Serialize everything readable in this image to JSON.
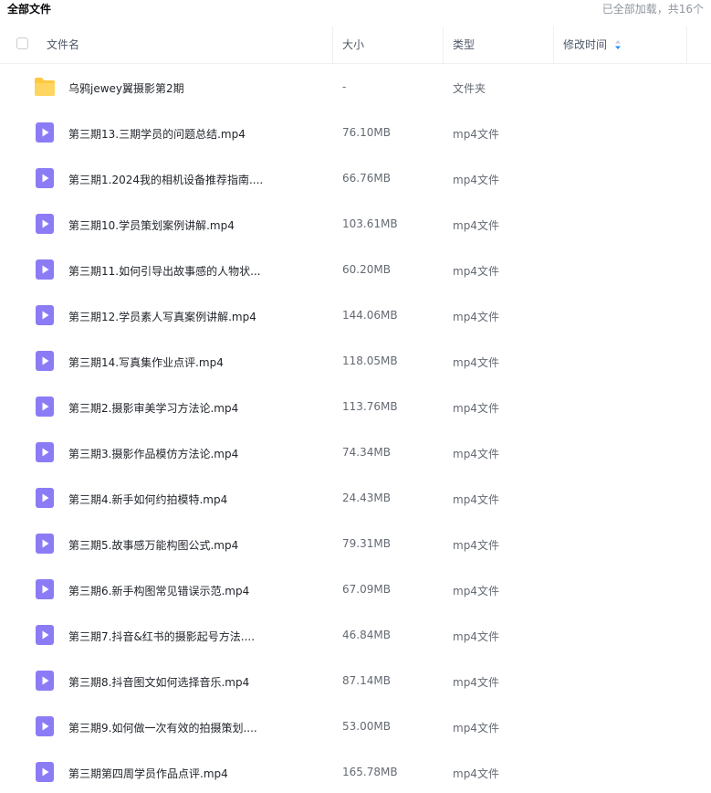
{
  "breadcrumb": "全部文件",
  "load_status": "已全部加载，共16个",
  "columns": {
    "name": "文件名",
    "size": "大小",
    "type": "类型",
    "modified": "修改时间"
  },
  "icons": {
    "folder": "folder-icon",
    "video": "video-file-icon",
    "sort": "sort-icon",
    "checkbox": "checkbox"
  },
  "colors": {
    "folder": "#ffc83d",
    "video": "#8b7cf6",
    "sort_active": "#1e90ff"
  },
  "rows": [
    {
      "kind": "folder",
      "name": "乌鸦jewey翼摄影第2期",
      "size": "-",
      "type": "文件夹"
    },
    {
      "kind": "video",
      "name": "第三期13.三期学员的问题总结.mp4",
      "size": "76.10MB",
      "type": "mp4文件"
    },
    {
      "kind": "video",
      "name": "第三期1.2024我的相机设备推荐指南....",
      "size": "66.76MB",
      "type": "mp4文件"
    },
    {
      "kind": "video",
      "name": "第三期10.学员策划案例讲解.mp4",
      "size": "103.61MB",
      "type": "mp4文件"
    },
    {
      "kind": "video",
      "name": "第三期11.如何引导出故事感的人物状...",
      "size": "60.20MB",
      "type": "mp4文件"
    },
    {
      "kind": "video",
      "name": "第三期12.学员素人写真案例讲解.mp4",
      "size": "144.06MB",
      "type": "mp4文件"
    },
    {
      "kind": "video",
      "name": "第三期14.写真集作业点评.mp4",
      "size": "118.05MB",
      "type": "mp4文件"
    },
    {
      "kind": "video",
      "name": "第三期2.摄影审美学习方法论.mp4",
      "size": "113.76MB",
      "type": "mp4文件"
    },
    {
      "kind": "video",
      "name": "第三期3.摄影作品模仿方法论.mp4",
      "size": "74.34MB",
      "type": "mp4文件"
    },
    {
      "kind": "video",
      "name": "第三期4.新手如何约拍模特.mp4",
      "size": "24.43MB",
      "type": "mp4文件"
    },
    {
      "kind": "video",
      "name": "第三期5.故事感万能构图公式.mp4",
      "size": "79.31MB",
      "type": "mp4文件"
    },
    {
      "kind": "video",
      "name": "第三期6.新手构图常见错误示范.mp4",
      "size": "67.09MB",
      "type": "mp4文件"
    },
    {
      "kind": "video",
      "name": "第三期7.抖音&红书的摄影起号方法....",
      "size": "46.84MB",
      "type": "mp4文件"
    },
    {
      "kind": "video",
      "name": "第三期8.抖音图文如何选择音乐.mp4",
      "size": "87.14MB",
      "type": "mp4文件"
    },
    {
      "kind": "video",
      "name": "第三期9.如何做一次有效的拍摄策划....",
      "size": "53.00MB",
      "type": "mp4文件"
    },
    {
      "kind": "video",
      "name": "第三期第四周学员作品点评.mp4",
      "size": "165.78MB",
      "type": "mp4文件"
    }
  ]
}
